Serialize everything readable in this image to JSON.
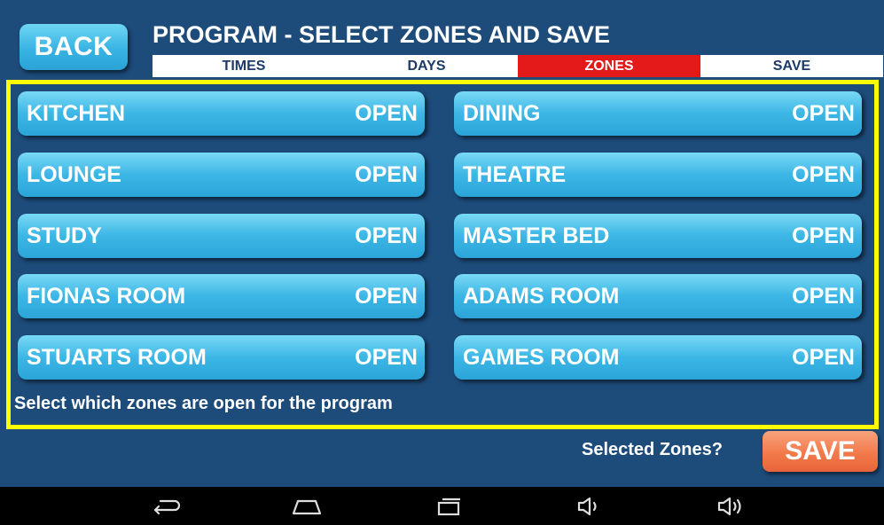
{
  "header": {
    "back_label": "BACK",
    "title": "PROGRAM - SELECT ZONES AND SAVE"
  },
  "tabs": [
    {
      "label": "TIMES",
      "active": false
    },
    {
      "label": "DAYS",
      "active": false
    },
    {
      "label": "ZONES",
      "active": true
    },
    {
      "label": "SAVE",
      "active": false
    }
  ],
  "zones": [
    {
      "name": "KITCHEN",
      "status": "OPEN"
    },
    {
      "name": "DINING",
      "status": "OPEN"
    },
    {
      "name": "LOUNGE",
      "status": "OPEN"
    },
    {
      "name": "THEATRE",
      "status": "OPEN"
    },
    {
      "name": "STUDY",
      "status": "OPEN"
    },
    {
      "name": "MASTER BED",
      "status": "OPEN"
    },
    {
      "name": "FIONAS ROOM",
      "status": "OPEN"
    },
    {
      "name": "ADAMS ROOM",
      "status": "OPEN"
    },
    {
      "name": "STUARTS ROOM",
      "status": "OPEN"
    },
    {
      "name": "GAMES ROOM",
      "status": "OPEN"
    }
  ],
  "hint_text": "Select which zones are open for the program",
  "footer": {
    "selected_label": "Selected Zones?",
    "save_label": "SAVE"
  },
  "navbar": {
    "icons": [
      "back-icon",
      "home-icon",
      "recent-apps-icon",
      "volume-down-icon",
      "volume-up-icon"
    ]
  },
  "colors": {
    "background": "#1d4b7a",
    "zone_button": "#3cb6e5",
    "active_tab": "#e41919",
    "panel_border": "#ffff00",
    "save_button": "#f27a4a"
  }
}
